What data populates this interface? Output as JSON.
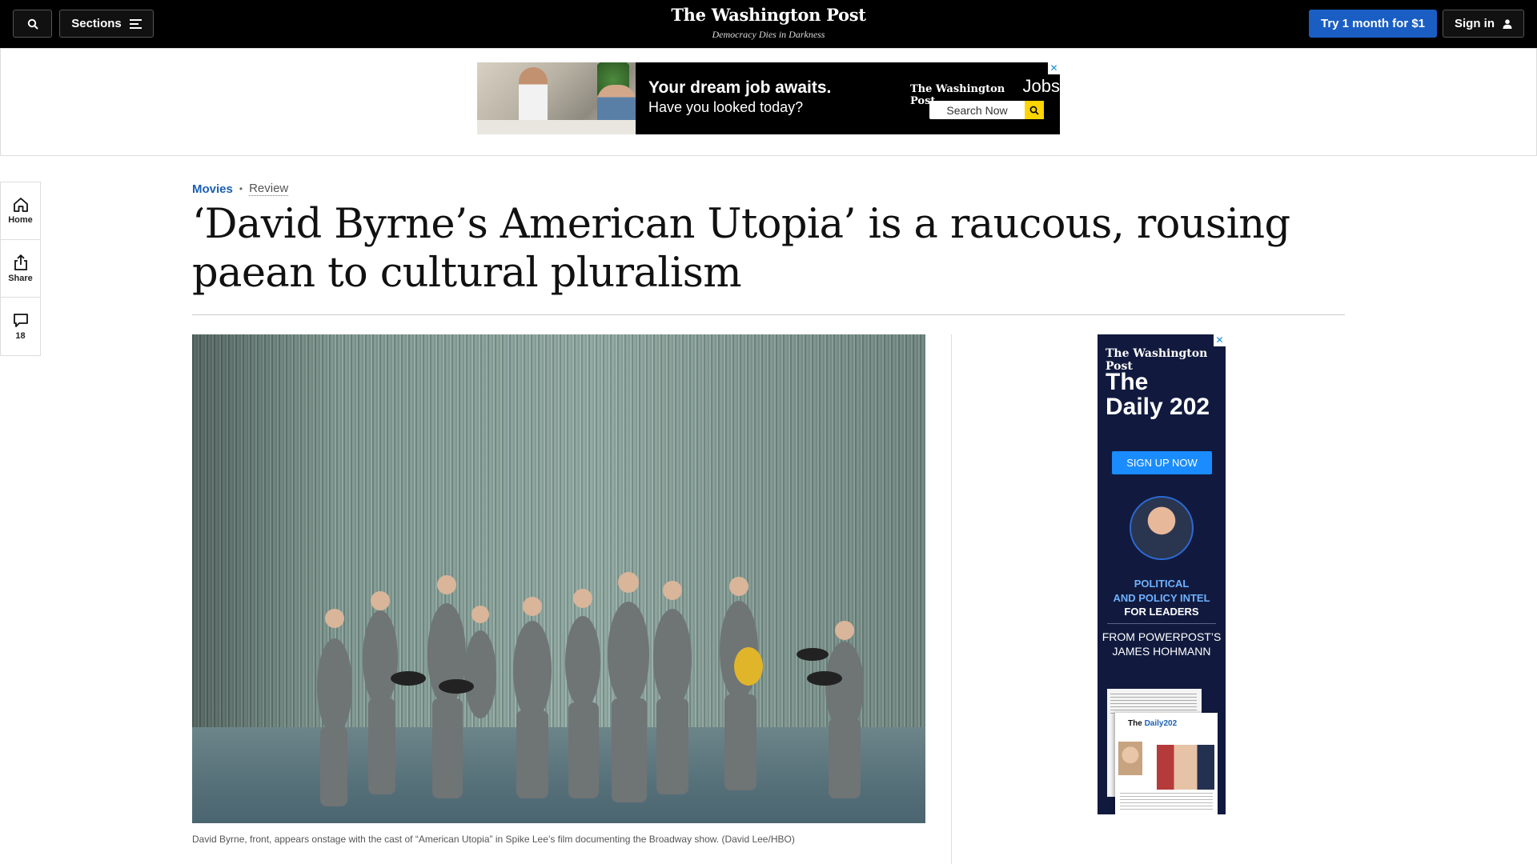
{
  "topbar": {
    "sections_label": "Sections",
    "logo": "The Washington Post",
    "tagline": "Democracy Dies in Darkness",
    "try_label": "Try 1 month for $1",
    "signin_label": "Sign in"
  },
  "top_ad": {
    "headline": "Your dream job awaits.",
    "subline": "Have you looked today?",
    "brand": "The Washington Post",
    "brand_suffix": "Jobs",
    "search_label": "Search Now",
    "close": "✕"
  },
  "rail": {
    "home_label": "Home",
    "share_label": "Share",
    "comments_count": "18"
  },
  "article": {
    "section": "Movies",
    "separator": "•",
    "kicker": "Review",
    "headline": "‘David Byrne’s American Utopia’ is a raucous, rousing paean to cultural pluralism",
    "caption": "David Byrne, front, appears onstage with the cast of “American Utopia” in Spike Lee’s film documenting the Broadway show. (David Lee/HBO)"
  },
  "side_ad": {
    "brand": "The Washington Post",
    "title_line1": "The",
    "title_line2": "Daily 202",
    "cta": "SIGN UP NOW",
    "tag_line1": "POLITICAL",
    "tag_line2": "AND POLICY INTEL",
    "tag_line3": "FOR LEADERS",
    "from_line1": "FROM POWERPOST’S",
    "from_line2": "JAMES HOHMANN",
    "paper_title_a": "The",
    "paper_title_b": "Daily202",
    "close": "✕"
  },
  "colors": {
    "accent_blue": "#1a5ec4",
    "section_link": "#1a5fb4",
    "ad_navy": "#111a3e"
  }
}
